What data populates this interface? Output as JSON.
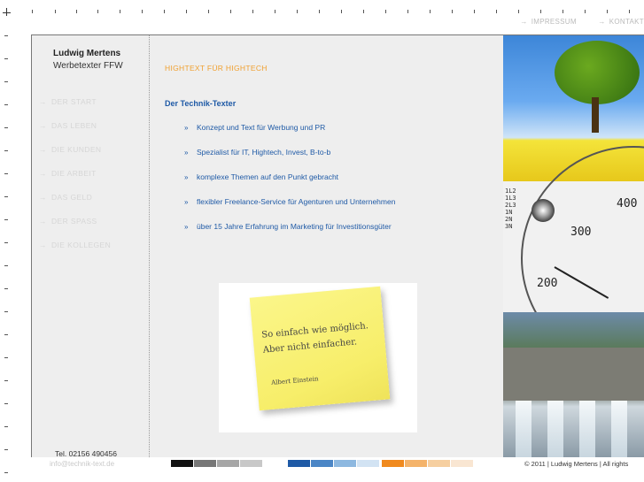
{
  "topnav": {
    "items": [
      {
        "arrow": "→",
        "label": "IMPRESSUM"
      },
      {
        "arrow": "→",
        "label": "KONTAKT"
      }
    ]
  },
  "sidebar": {
    "brand_name": "Ludwig Mertens",
    "brand_sub": "Werbetexter FFW",
    "nav": [
      {
        "arrow": "→",
        "label": "DER START"
      },
      {
        "arrow": "→",
        "label": "DAS LEBEN"
      },
      {
        "arrow": "→",
        "label": "DIE KUNDEN"
      },
      {
        "arrow": "→",
        "label": "DIE ARBEIT"
      },
      {
        "arrow": "→",
        "label": "DAS GELD"
      },
      {
        "arrow": "→",
        "label": "DER SPASS"
      },
      {
        "arrow": "→",
        "label": "DIE KOLLEGEN"
      }
    ]
  },
  "content": {
    "kicker": "HIGHTEXT FÜR HIGHTECH",
    "headline": "Der Technik-Texter",
    "bullet_mark": "»",
    "bullets": [
      "Konzept und Text für Werbung und PR",
      "Spezialist für IT, Hightech, Invest, B-to-b",
      "komplexe Themen auf den Punkt gebracht",
      "flexibler Freelance-Service für Agenturen und Unternehmen",
      "über 15 Jahre Erfahrung im Marketing für Investitionsgüter"
    ],
    "quote": {
      "line1": "So einfach wie möglich.",
      "line2": "Aber nicht einfacher.",
      "author": "Albert Einstein"
    }
  },
  "gauge": {
    "labels": [
      "400",
      "300",
      "200"
    ],
    "small_labels": "1L2\n1L3\n2L3\n1N\n2N\n3N"
  },
  "footer": {
    "tel": "Tel. 02156 490456",
    "mail": "info@technik-text.de",
    "copyright": "© 2011 | Ludwig Mertens | All rights",
    "swatches": [
      "#111111",
      "#777777",
      "#a6a6a6",
      "#c8c8c8",
      "#1f5aa6",
      "#4b86c6",
      "#8db8e0",
      "#d2e3f3",
      "#f08a1e",
      "#f4b36a",
      "#f6cfa0",
      "#f9e6d2"
    ]
  }
}
